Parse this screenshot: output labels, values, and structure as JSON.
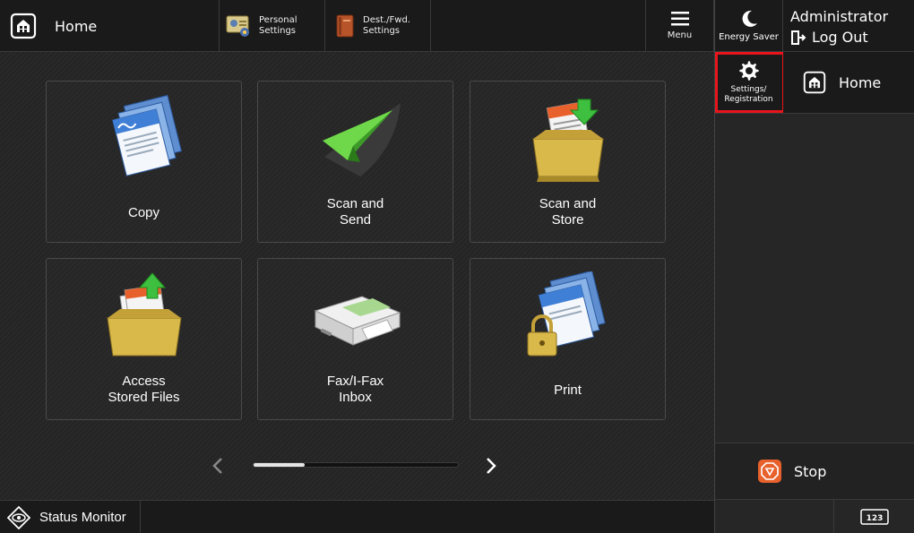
{
  "header": {
    "home_label": "Home",
    "personal_settings_label": "Personal\nSettings",
    "dest_fwd_settings_label": "Dest./Fwd.\nSettings",
    "menu_label": "Menu"
  },
  "side": {
    "energy_saver_label": "Energy Saver",
    "user_name": "Administrator",
    "logout_label": "Log Out",
    "settings_label": "Settings/\nRegistration",
    "home_label": "Home",
    "stop_label": "Stop",
    "keypad_label": "123"
  },
  "tiles": [
    {
      "label": "Copy",
      "icon": "copy-icon"
    },
    {
      "label": "Scan and\nSend",
      "icon": "scan-send-icon"
    },
    {
      "label": "Scan and\nStore",
      "icon": "scan-store-icon"
    },
    {
      "label": "Access\nStored Files",
      "icon": "stored-files-icon"
    },
    {
      "label": "Fax/I-Fax\nInbox",
      "icon": "fax-inbox-icon"
    },
    {
      "label": "Print",
      "icon": "print-icon"
    }
  ],
  "pager": {
    "progress": 0.25
  },
  "footer": {
    "status_monitor_label": "Status Monitor"
  },
  "colors": {
    "highlight": "#e8141c",
    "stop_orange": "#e8612c",
    "accent_green": "#3fbf3f"
  }
}
